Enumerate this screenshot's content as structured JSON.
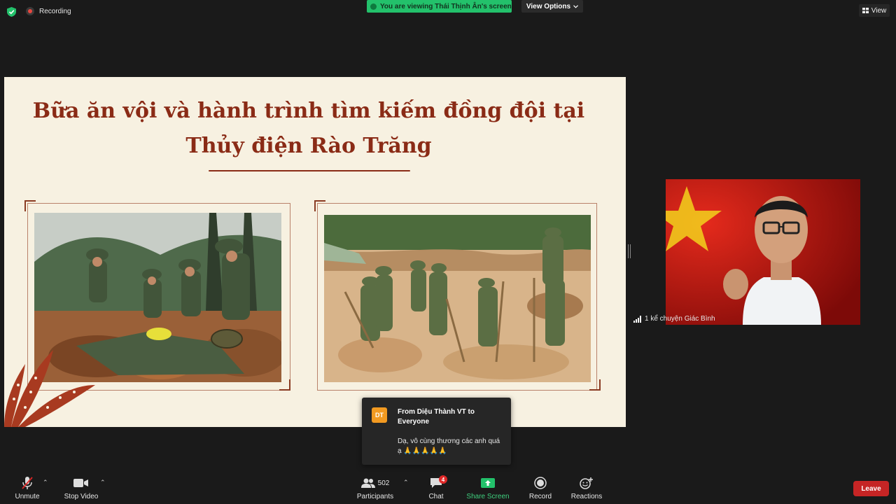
{
  "top": {
    "recording_label": "Recording",
    "viewing_banner": "You are viewing Thái Thịnh Ân's screen",
    "view_options_label": "View Options",
    "view_label": "View",
    "colors": {
      "viewing_banner": "#23c16b",
      "recording_dot": "#e8473f"
    }
  },
  "slide": {
    "title_line1": "Bữa ăn vội và hành trình tìm kiếm đồng đội tại",
    "title_line2": "Thủy điện Rào Trăng",
    "colors": {
      "background": "#f7f1e1",
      "accent": "#8a2b16"
    }
  },
  "video": {
    "participant_name": "1 kể chuyện Giác Bình"
  },
  "chat_popup": {
    "avatar_initials": "DT",
    "from": "From Diệu Thành VT to Everyone",
    "message": "Dạ, vô cùng thương các anh quá ạ 🙏🙏🙏🙏🙏"
  },
  "toolbar": {
    "unmute_label": "Unmute",
    "stop_video_label": "Stop Video",
    "participants_label": "Participants",
    "participants_count": "502",
    "chat_label": "Chat",
    "chat_badge": "4",
    "share_screen_label": "Share Screen",
    "record_label": "Record",
    "reactions_label": "Reactions",
    "leave_label": "Leave",
    "colors": {
      "share_screen": "#23c16b",
      "leave": "#c62525",
      "badge": "#e02828"
    }
  },
  "icons": [
    "shield-check-icon",
    "record-dot-icon",
    "chevron-down-icon",
    "grid-view-icon",
    "mic-muted-icon",
    "video-camera-icon",
    "participants-icon",
    "chat-bubble-icon",
    "share-screen-icon",
    "record-icon",
    "reaction-emoji-icon",
    "signal-icon"
  ]
}
